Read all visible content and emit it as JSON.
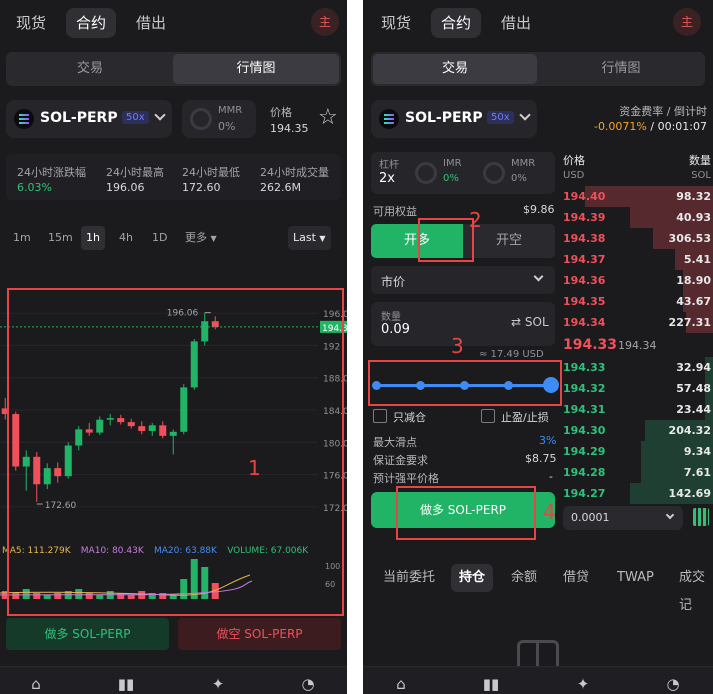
{
  "left": {
    "nav": [
      "现货",
      "合约",
      "借出"
    ],
    "avatar": "主",
    "views": [
      "交易",
      "行情图"
    ],
    "market": {
      "name": "SOL-PERP",
      "leverage": "50x",
      "mmr_label": "MMR",
      "mmr_value": "0%",
      "price_label": "价格",
      "price_value": "194.35"
    },
    "stats": [
      {
        "label": "24小时涨跌幅",
        "value": "6.03%"
      },
      {
        "label": "24小时最高",
        "value": "196.06"
      },
      {
        "label": "24小时最低",
        "value": "172.60"
      },
      {
        "label": "24小时成交量",
        "value": "262.6M"
      }
    ],
    "timeframes": [
      "1m",
      "15m",
      "1h",
      "4h",
      "1D",
      "更多"
    ],
    "price_type": "Last",
    "buy_label": "做多 SOL-PERP",
    "sell_label": "做空 SOL-PERP",
    "highlight_number": "1"
  },
  "chart_data": {
    "type": "candlestick",
    "y_ticks": [
      "196.0",
      "192",
      "188.0",
      "184.0",
      "180.0",
      "176.0",
      "172.0"
    ],
    "ylim": [
      170,
      198
    ],
    "current_price_tag": "194.3",
    "high_annotation": "196.06",
    "low_annotation": "172.60",
    "candles": [
      {
        "o": 184.2,
        "h": 185.5,
        "l": 182.8,
        "c": 183.5
      },
      {
        "o": 183.5,
        "h": 183.8,
        "l": 176.5,
        "c": 177.0
      },
      {
        "o": 177.0,
        "h": 179.0,
        "l": 174.0,
        "c": 178.2
      },
      {
        "o": 178.2,
        "h": 178.8,
        "l": 172.6,
        "c": 174.8
      },
      {
        "o": 174.8,
        "h": 177.4,
        "l": 174.2,
        "c": 176.8
      },
      {
        "o": 176.8,
        "h": 177.5,
        "l": 175.0,
        "c": 175.8
      },
      {
        "o": 175.8,
        "h": 180.0,
        "l": 175.5,
        "c": 179.6
      },
      {
        "o": 179.6,
        "h": 182.0,
        "l": 179.0,
        "c": 181.6
      },
      {
        "o": 181.6,
        "h": 182.4,
        "l": 180.8,
        "c": 181.2
      },
      {
        "o": 181.2,
        "h": 183.2,
        "l": 180.9,
        "c": 182.8
      },
      {
        "o": 182.8,
        "h": 183.5,
        "l": 182.1,
        "c": 183.0
      },
      {
        "o": 183.0,
        "h": 183.4,
        "l": 182.2,
        "c": 182.5
      },
      {
        "o": 182.5,
        "h": 182.9,
        "l": 181.7,
        "c": 182.0
      },
      {
        "o": 182.0,
        "h": 182.6,
        "l": 181.0,
        "c": 181.4
      },
      {
        "o": 181.4,
        "h": 182.4,
        "l": 180.8,
        "c": 182.1
      },
      {
        "o": 182.1,
        "h": 182.6,
        "l": 180.5,
        "c": 180.8
      },
      {
        "o": 180.8,
        "h": 181.6,
        "l": 178.5,
        "c": 181.3
      },
      {
        "o": 181.3,
        "h": 187.2,
        "l": 181.0,
        "c": 186.8
      },
      {
        "o": 186.8,
        "h": 192.8,
        "l": 186.5,
        "c": 192.5
      },
      {
        "o": 192.5,
        "h": 196.06,
        "l": 192.0,
        "c": 195.0
      },
      {
        "o": 195.0,
        "h": 195.6,
        "l": 194.0,
        "c": 194.3
      }
    ],
    "volume_values": [
      4,
      3,
      5,
      3,
      2,
      3,
      4,
      5,
      3,
      2,
      4,
      3,
      2,
      4,
      3,
      3,
      2,
      10,
      20,
      16,
      8
    ],
    "indicators": [
      {
        "name": "MA5",
        "value": "111.279K",
        "color": "#e6b84a"
      },
      {
        "name": "MA10",
        "value": "80.43K",
        "color": "#c97be0"
      },
      {
        "name": "MA20",
        "value": "63.88K",
        "color": "#4a8cf0"
      },
      {
        "name": "VOLUME",
        "value": "67.006K",
        "color": "#2fc17a"
      }
    ],
    "volume_ticks": [
      "100",
      "60"
    ]
  },
  "right": {
    "nav": [
      "现货",
      "合约",
      "借出"
    ],
    "avatar": "主",
    "views": [
      "交易",
      "行情图"
    ],
    "market": {
      "name": "SOL-PERP",
      "leverage": "50x"
    },
    "funding": {
      "label": "资金费率 / 倒计时",
      "rate": "-0.0071%",
      "sep": " / ",
      "countdown": "00:01:07"
    },
    "leverage": {
      "label": "杠杆",
      "value": "2x"
    },
    "imr": {
      "label": "IMR",
      "value": "0%"
    },
    "mmr": {
      "label": "MMR",
      "value": "0%"
    },
    "available": {
      "label": "可用权益",
      "value": "$9.86"
    },
    "side_buy": "开多",
    "side_sell": "开空",
    "order_type": "市价",
    "qty": {
      "label": "数量",
      "value": "0.09",
      "unit": "SOL"
    },
    "approx": "≈ 17.49 USD",
    "slider_percent": 100,
    "reduce_only": "只减仓",
    "tp_sl": "止盈/止损",
    "max_slippage": {
      "label": "最大滑点",
      "value": "3%"
    },
    "margin_req": {
      "label": "保证金要求",
      "value": "$8.75"
    },
    "liq_price": {
      "label": "预计强平价格",
      "value": "-"
    },
    "submit": "做多 SOL-PERP",
    "ob_header": {
      "price": "价格",
      "qty": "数量",
      "price_unit": "USD",
      "qty_unit": "SOL"
    },
    "asks": [
      {
        "p": "194.40",
        "q": "98.32",
        "d": 0.85
      },
      {
        "p": "194.39",
        "q": "40.93",
        "d": 0.55
      },
      {
        "p": "194.38",
        "q": "306.53",
        "d": 0.4
      },
      {
        "p": "194.37",
        "q": "5.41",
        "d": 0.25
      },
      {
        "p": "194.36",
        "q": "18.90",
        "d": 0.2
      },
      {
        "p": "194.35",
        "q": "43.67",
        "d": 0.2
      },
      {
        "p": "194.34",
        "q": "227.31",
        "d": 0.18
      }
    ],
    "mid": {
      "price": "194.33",
      "ref": "194.34"
    },
    "bids": [
      {
        "p": "194.33",
        "q": "32.94",
        "d": 0.05
      },
      {
        "p": "194.32",
        "q": "57.48",
        "d": 0.05
      },
      {
        "p": "194.31",
        "q": "23.44",
        "d": 0.05
      },
      {
        "p": "194.30",
        "q": "204.32",
        "d": 0.45
      },
      {
        "p": "194.29",
        "q": "9.34",
        "d": 0.48
      },
      {
        "p": "194.28",
        "q": "7.61",
        "d": 0.48
      },
      {
        "p": "194.27",
        "q": "142.69",
        "d": 0.55
      }
    ],
    "tick_size": "0.0001",
    "bottom_tabs": [
      "当前委托",
      "持仓",
      "余额",
      "借贷",
      "TWAP",
      "成交记"
    ],
    "highlight_numbers": [
      "2",
      "3",
      "4"
    ]
  }
}
